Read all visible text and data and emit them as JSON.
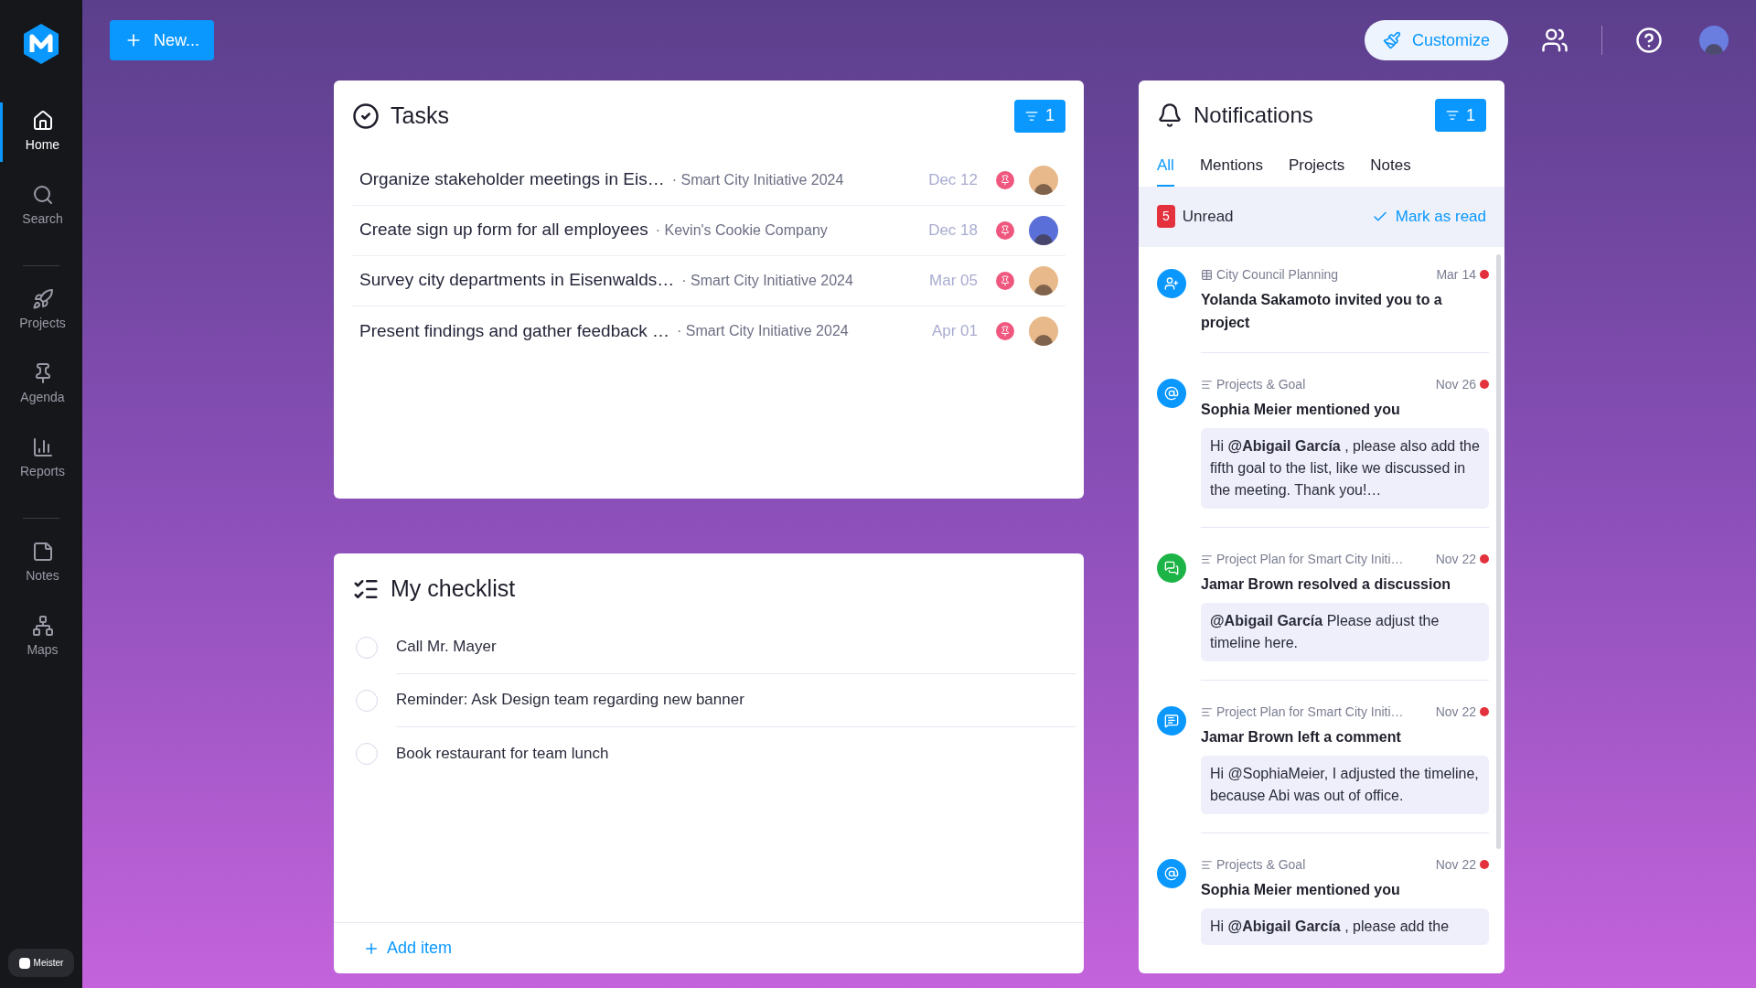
{
  "sidebar": {
    "items": [
      {
        "label": "Home",
        "selected": true
      },
      {
        "label": "Search",
        "selected": false
      },
      {
        "kind": "divider"
      },
      {
        "label": "Projects",
        "selected": false
      },
      {
        "label": "Agenda",
        "selected": false
      },
      {
        "label": "Reports",
        "selected": false
      },
      {
        "kind": "divider"
      },
      {
        "label": "Notes",
        "selected": false
      },
      {
        "label": "Maps",
        "selected": false
      }
    ],
    "brand": "Meister"
  },
  "topbar": {
    "new_button": "New...",
    "customize_button": "Customize"
  },
  "tasks": {
    "title": "Tasks",
    "filter_count": "1",
    "rows": [
      {
        "title": "Organize stakeholder meetings in Eis…",
        "project": "· Smart City Initiative 2024",
        "date": "Dec 12",
        "color": "#e8b98a"
      },
      {
        "title": "Create sign up form for all employees",
        "project": "· Kevin's Cookie Company",
        "date": "Dec 18",
        "color": "#5b6fd8"
      },
      {
        "title": "Survey city departments in Eisenwalds…",
        "project": "· Smart City Initiative 2024",
        "date": "Mar 05",
        "color": "#e8b98a"
      },
      {
        "title": "Present findings and gather feedback …",
        "project": "· Smart City Initiative 2024",
        "date": "Apr 01",
        "color": "#e8b98a"
      }
    ]
  },
  "checklist": {
    "title": "My checklist",
    "items": [
      {
        "label": "Call Mr. Mayer",
        "checked": false
      },
      {
        "label": "Reminder: Ask Design team regarding new banner",
        "checked": false
      },
      {
        "label": "Book restaurant for team lunch",
        "checked": false
      }
    ],
    "add_item": "Add item"
  },
  "notifications": {
    "title": "Notifications",
    "filter_count": "1",
    "tabs": [
      {
        "label": "All",
        "selected": true
      },
      {
        "label": "Mentions",
        "selected": false
      },
      {
        "label": "Projects",
        "selected": false
      },
      {
        "label": "Notes",
        "selected": false
      }
    ],
    "unread_count": "5",
    "unread_label": "Unread",
    "mark_as_read": "Mark as read",
    "items": [
      {
        "kind": "invite",
        "source": "City Council Planning",
        "date": "Mar 14",
        "unread": true,
        "headline": "Yolanda Sakamoto invited you to a project"
      },
      {
        "kind": "mention",
        "source": "Projects & Goal",
        "date": "Nov 26",
        "unread": true,
        "headline": "Sophia Meier mentioned you",
        "body": "Hi **@Abigail García** , please also add the fifth goal to the list, like we discussed in the meeting. Thank you!…"
      },
      {
        "kind": "resolved",
        "source": "Project Plan for Smart City Initi…",
        "date": "Nov 22",
        "unread": true,
        "headline": "Jamar Brown resolved a discussion",
        "body": "**@Abigail García** Please adjust the timeline here."
      },
      {
        "kind": "comment",
        "source": "Project Plan for Smart City Initi…",
        "date": "Nov 22",
        "unread": true,
        "headline": "Jamar Brown left a comment",
        "body": "Hi @SophiaMeier, I adjusted the timeline, because Abi was out of office."
      },
      {
        "kind": "mention",
        "source": "Projects & Goal",
        "date": "Nov 22",
        "unread": true,
        "headline": "Sophia Meier mentioned you",
        "body": "Hi **@Abigail García** , please add the"
      }
    ]
  }
}
